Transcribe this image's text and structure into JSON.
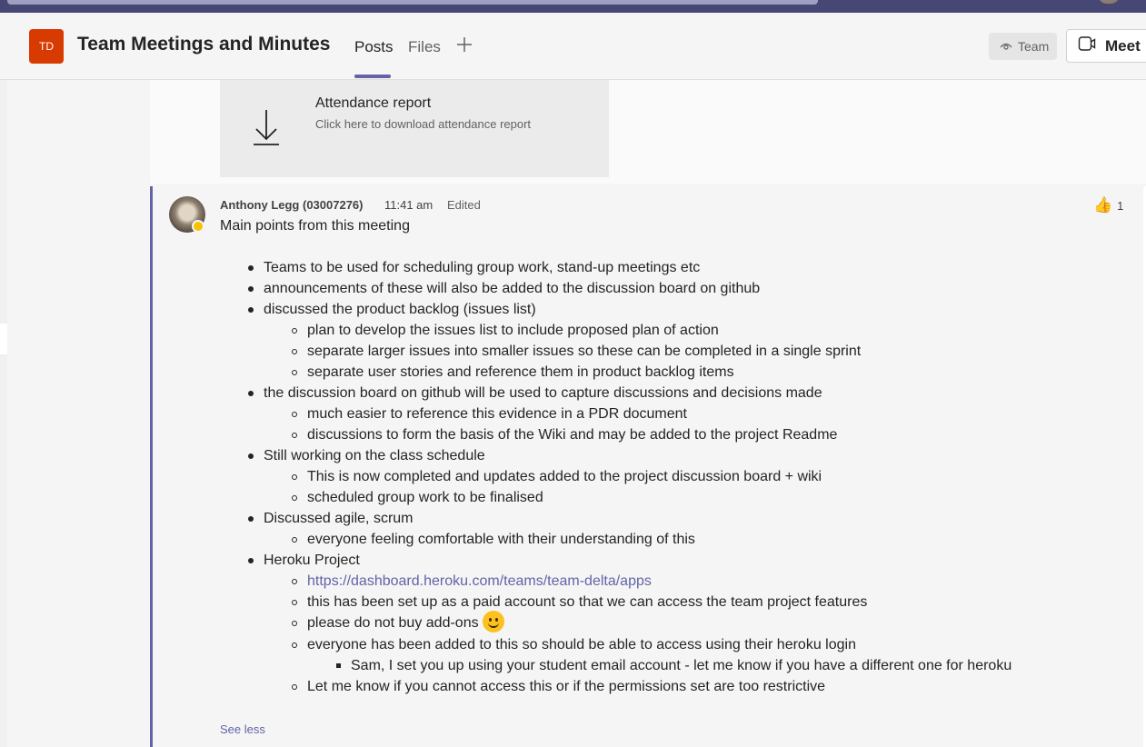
{
  "header": {
    "team_initials": "TD",
    "team_name": "Team Meetings and Minutes",
    "tabs": [
      {
        "label": "Posts",
        "active": true
      },
      {
        "label": "Files",
        "active": false
      }
    ],
    "team_button_label": "Team",
    "meet_button_label": "Meet"
  },
  "attendance_card": {
    "title": "Attendance report",
    "subtitle": "Click here to download attendance report",
    "icon": "download-icon"
  },
  "message": {
    "author": "Anthony Legg (03007276)",
    "time": "11:41 am",
    "edited_label": "Edited",
    "reaction": {
      "emoji": "👍",
      "count": "1"
    },
    "intro": "Main points from this meeting",
    "points": {
      "p1": "Teams to be used for scheduling group work, stand-up meetings etc",
      "p2": "announcements of these will also be added to the discussion board on github",
      "p3": "discussed the product backlog (issues list)",
      "p3a": "plan to develop the issues list to include proposed plan of action",
      "p3b": "separate larger issues into smaller issues so these can be completed in a single sprint",
      "p3c": "separate user stories and reference them in product backlog items",
      "p4": "the discussion board on github will be used to capture discussions and decisions made",
      "p4a": "much easier to reference this evidence in a PDR document",
      "p4b": "discussions to form the basis of the Wiki and may be added to the project Readme",
      "p5": "Still working on the class schedule",
      "p5a": "This is now completed and updates added to the project discussion board + wiki",
      "p5b": "scheduled group work to be finalised",
      "p6": "Discussed agile, scrum",
      "p6a": "everyone feeling comfortable with their understanding of this",
      "p7": "Heroku Project",
      "p7a": "https://dashboard.heroku.com/teams/team-delta/apps",
      "p7b": "this has been set up as a paid account so that we can access the team project features",
      "p7c": "please do not buy add-ons",
      "p7d": "everyone has been added to this so should be able to access using their heroku login",
      "p7d1": "Sam, I set you up using your student email account - let me know if you have a different one for heroku",
      "p7e": "Let me know if you cannot access this or if the permissions set are too restrictive"
    },
    "see_less_label": "See less"
  },
  "colors": {
    "brand": "#6264a7",
    "team_logo": "#d83b01",
    "status_away": "#f8c200"
  }
}
